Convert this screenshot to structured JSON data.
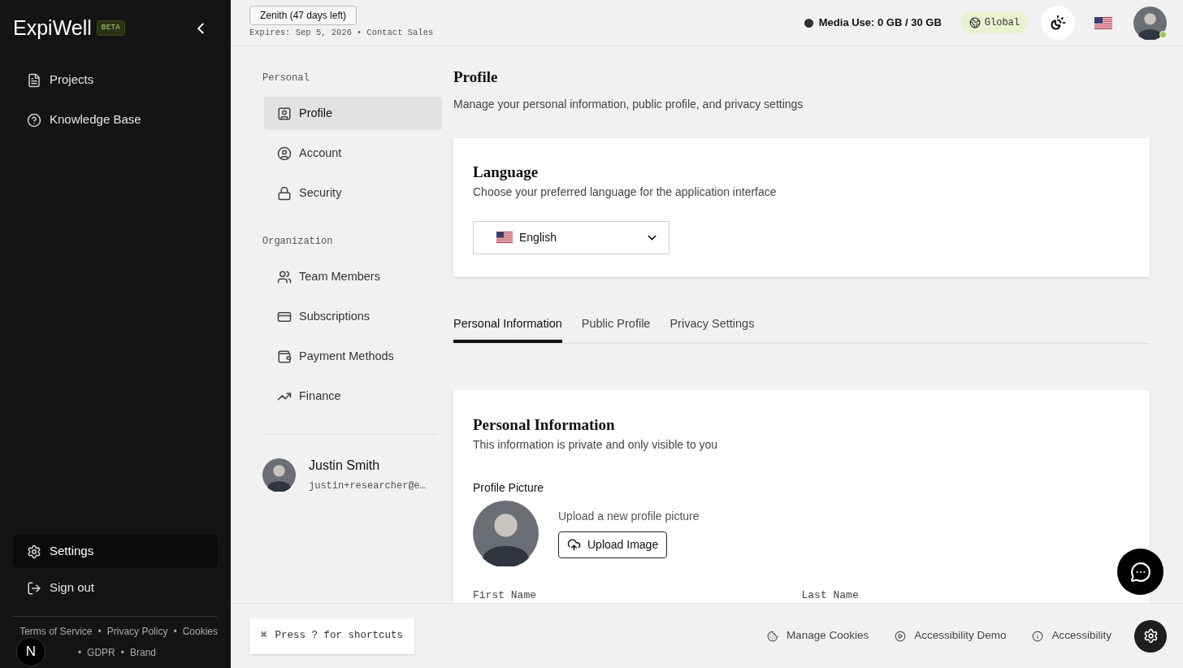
{
  "sidebar": {
    "logo": "ExpiWell",
    "logo_badge": "BETA",
    "nav": [
      {
        "label": "Projects",
        "selected": false
      },
      {
        "label": "Knowledge Base",
        "selected": false
      }
    ],
    "bottom_nav": [
      {
        "label": "Settings",
        "selected": true
      },
      {
        "label": "Sign out",
        "selected": false
      }
    ],
    "footer_links": [
      "Terms of Service",
      "Privacy Policy",
      "Cookies",
      "GDPR",
      "Brand"
    ],
    "separator": "•",
    "corner_badge": "N"
  },
  "topbar": {
    "plan": "Zenith (47 days left)",
    "expiry": "Expires: Sep 5, 2026",
    "separator": "•",
    "contact": "Contact Sales",
    "media_use": "Media Use: 0 GB / 30 GB",
    "region": "Global",
    "online": true
  },
  "settings_nav": [
    {
      "title": "Personal",
      "items": [
        {
          "label": "Profile",
          "selected": true
        },
        {
          "label": "Account",
          "selected": false
        },
        {
          "label": "Security",
          "selected": false
        }
      ]
    },
    {
      "title": "Organization",
      "items": [
        {
          "label": "Team Members",
          "selected": false
        },
        {
          "label": "Subscriptions",
          "selected": false
        },
        {
          "label": "Payment Methods",
          "selected": false
        },
        {
          "label": "Finance",
          "selected": false
        }
      ]
    }
  ],
  "user": {
    "name": "Justin Smith",
    "email": "justin+researcher@e…"
  },
  "page": {
    "title": "Profile",
    "subtitle": "Manage your personal information, public profile, and privacy settings"
  },
  "language_card": {
    "title": "Language",
    "description": "Choose your preferred language for the application interface",
    "value": "English"
  },
  "tabs": [
    {
      "label": "Personal Information",
      "selected": true
    },
    {
      "label": "Public Profile",
      "selected": false
    },
    {
      "label": "Privacy Settings",
      "selected": false
    }
  ],
  "personal_card": {
    "title": "Personal Information",
    "description": "This information is private and only visible to you",
    "picture_label": "Profile Picture",
    "upload_hint": "Upload a new profile picture",
    "upload_button": "Upload Image",
    "fields": [
      "First Name",
      "Last Name"
    ]
  },
  "footer": {
    "shortcut_key": "⌘",
    "shortcut": "Press ? for shortcuts",
    "links": [
      "Manage Cookies",
      "Accessibility Demo",
      "Accessibility"
    ]
  }
}
